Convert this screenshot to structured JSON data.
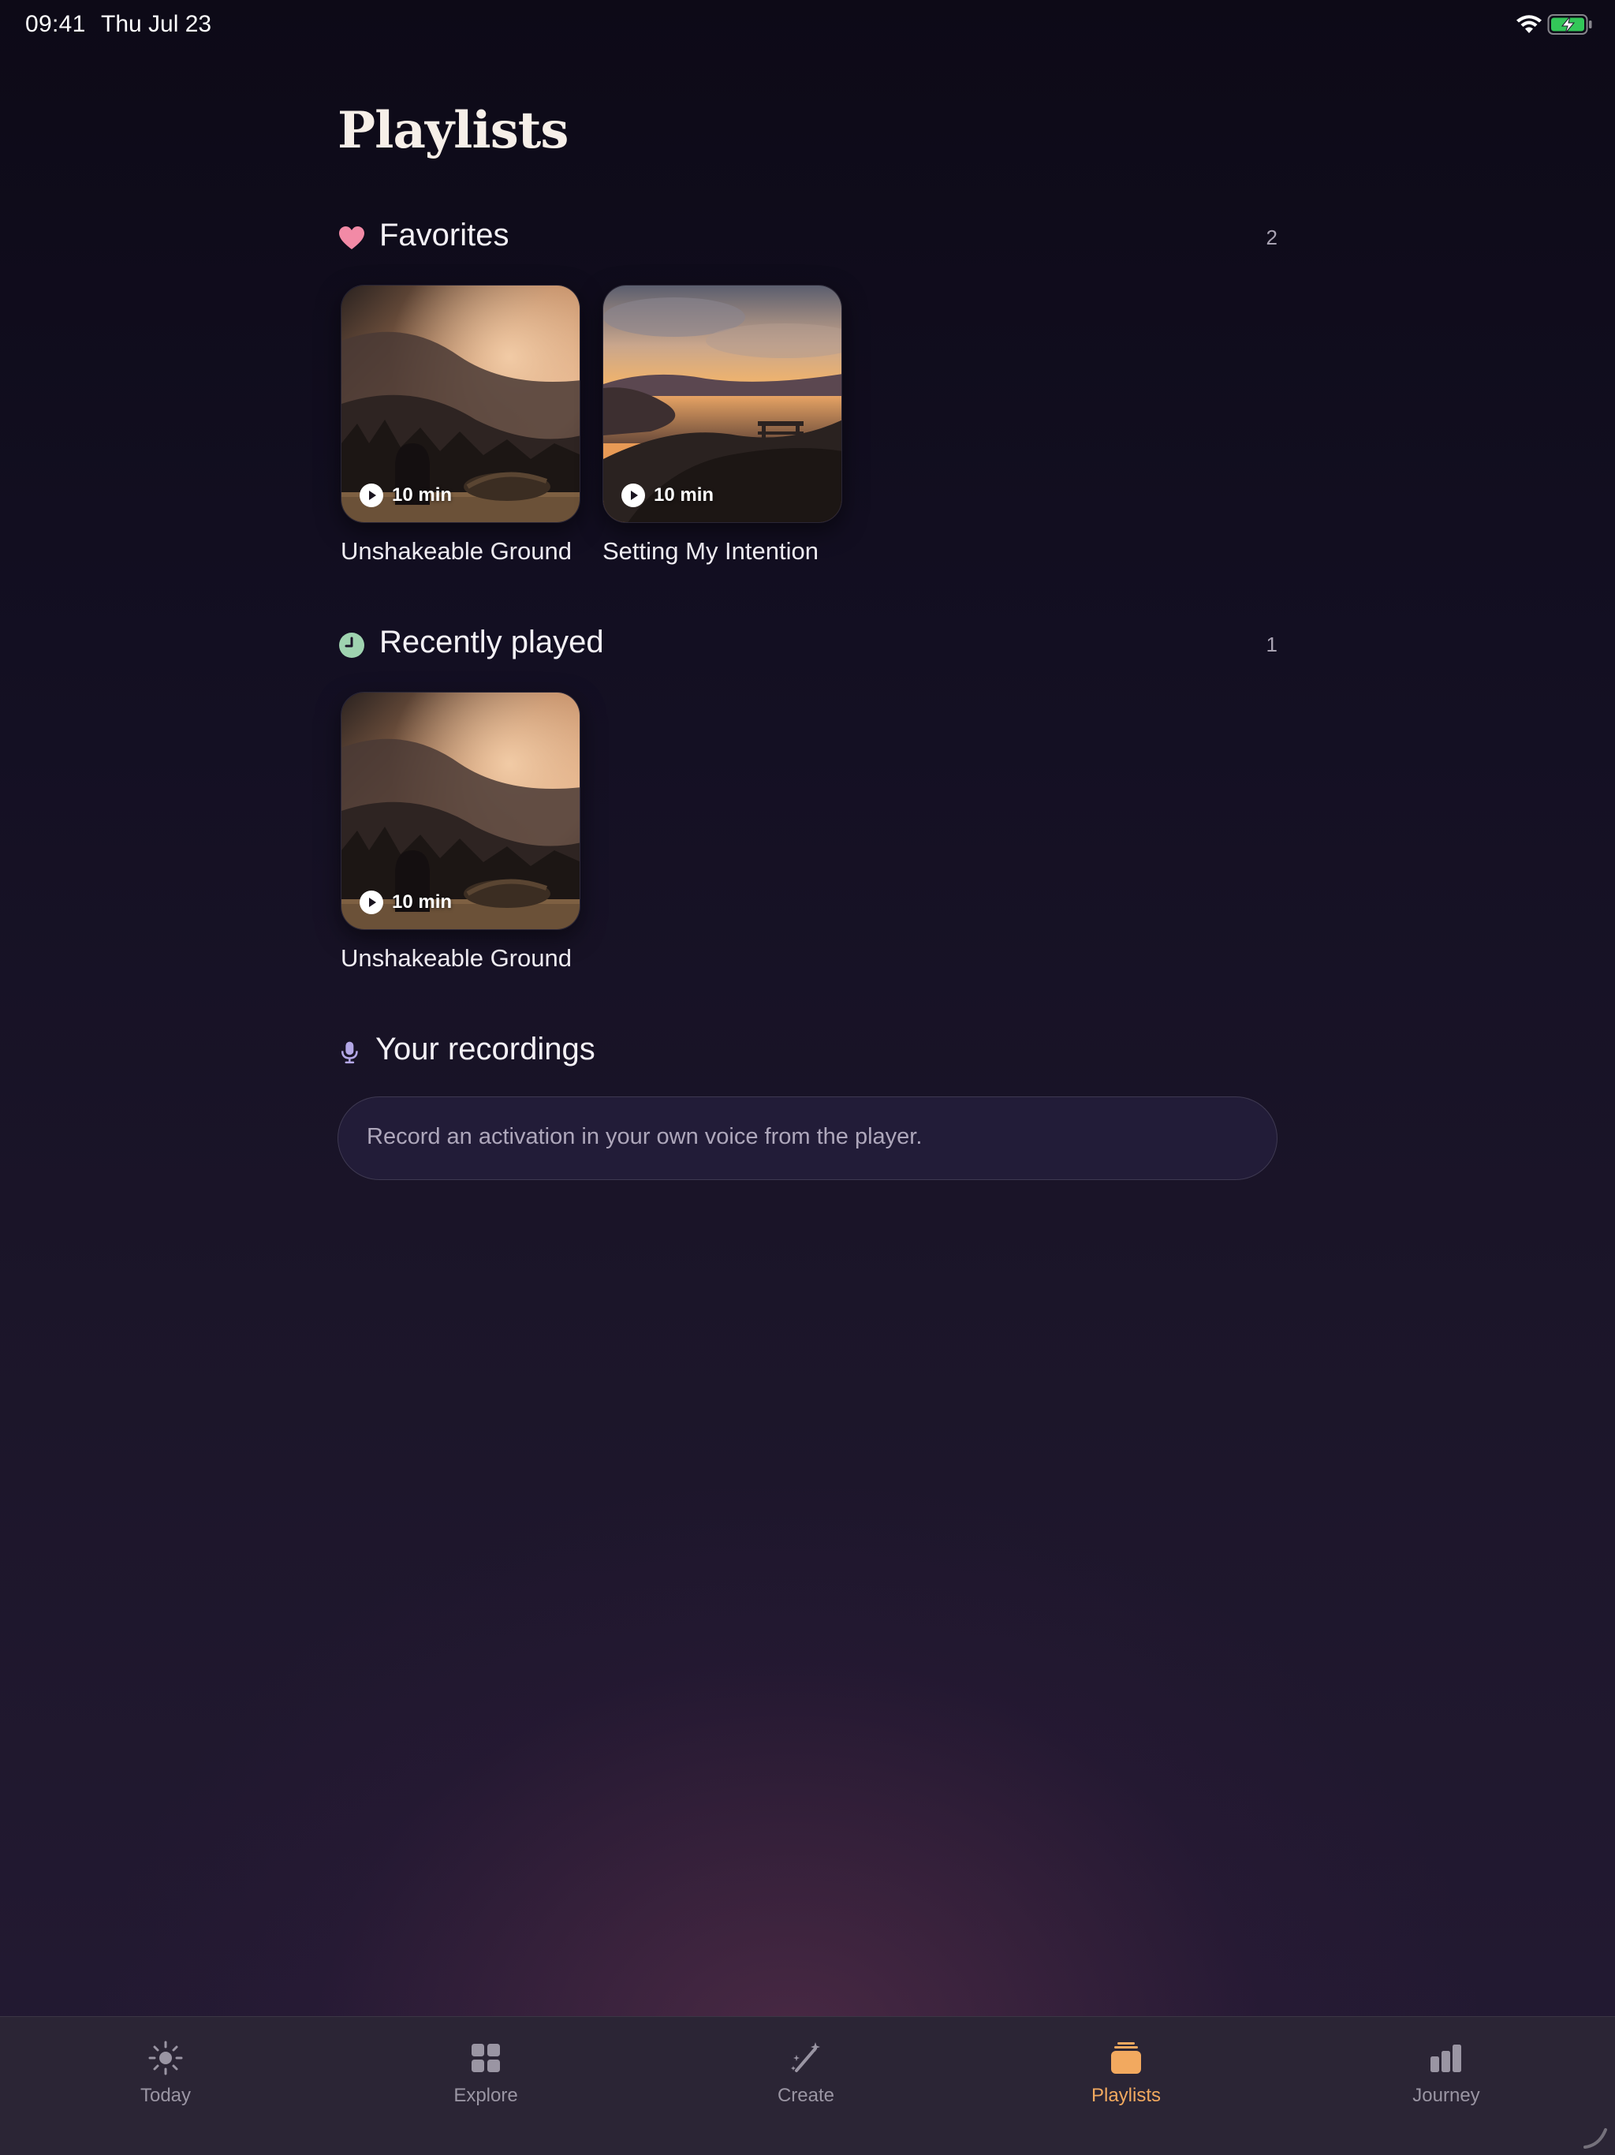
{
  "status_bar": {
    "time": "09:41",
    "date": "Thu Jul 23"
  },
  "page": {
    "title": "Playlists"
  },
  "favorites": {
    "title": "Favorites",
    "count": "2",
    "icon": "heart-icon",
    "icon_color": "#f28aa6",
    "items": [
      {
        "title": "Unshakeable Ground",
        "duration": "10 min"
      },
      {
        "title": "Setting My Intention",
        "duration": "10 min"
      }
    ]
  },
  "recent": {
    "title": "Recently played",
    "count": "1",
    "icon": "clock-icon",
    "icon_color": "#9fd3b0",
    "items": [
      {
        "title": "Unshakeable Ground",
        "duration": "10 min"
      }
    ]
  },
  "recordings": {
    "title": "Your recordings",
    "icon": "microphone-icon",
    "icon_color": "#b3a7e6",
    "empty_text": "Record an activation in your own voice from the player."
  },
  "tabs": [
    {
      "label": "Today",
      "icon": "sun-icon"
    },
    {
      "label": "Explore",
      "icon": "grid-icon"
    },
    {
      "label": "Create",
      "icon": "magic-wand-icon"
    },
    {
      "label": "Playlists",
      "icon": "stack-icon",
      "active": true
    },
    {
      "label": "Journey",
      "icon": "bar-chart-icon"
    }
  ],
  "colors": {
    "accent": "#f2a95f",
    "inactive_tab": "#9a95a3",
    "background": "#130f22"
  }
}
